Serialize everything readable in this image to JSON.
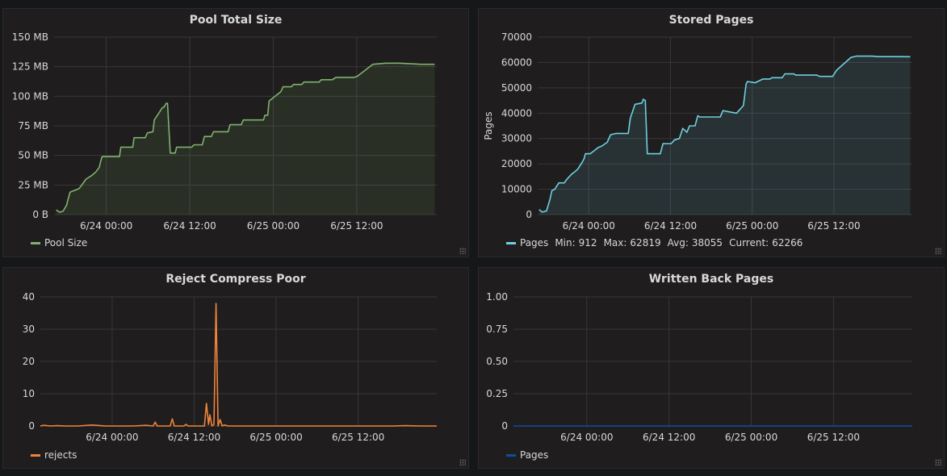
{
  "panels": [
    {
      "title": "Pool Total Size",
      "legend": {
        "name": "Pool Size",
        "color": "#7eb26d"
      },
      "chart_data": {
        "type": "area",
        "title": "Pool Total Size",
        "x_ticks": [
          "6/24 00:00",
          "6/24 12:00",
          "6/25 00:00",
          "6/25 12:00"
        ],
        "x_tick_hours": [
          15,
          27,
          39,
          51
        ],
        "x_range_hours": [
          7.5,
          62.5
        ],
        "y_ticks": [
          "0 B",
          "25 MB",
          "50 MB",
          "75 MB",
          "100 MB",
          "125 MB",
          "150 MB"
        ],
        "ylim": [
          0,
          150
        ],
        "y_unit": "MB",
        "color": "#7eb26d",
        "fill": true,
        "series": [
          {
            "name": "Pool Size",
            "x_hours": [
              7.8,
              8.3,
              8.8,
              9.3,
              9.6,
              9.8,
              10.2,
              11.1,
              11.6,
              12.1,
              12.9,
              13.5,
              14,
              14.2,
              14.4,
              16.9,
              17.1,
              18.8,
              19,
              20.6,
              20.9,
              21.7,
              21.9,
              22.8,
              23,
              23.3,
              23.6,
              23.8,
              24.2,
              24.9,
              25.1,
              27.3,
              27.6,
              28.8,
              29.1,
              30.1,
              30.4,
              32.5,
              32.8,
              34.4,
              34.7,
              37.6,
              37.8,
              38.2,
              38.4,
              40.1,
              40.4,
              41.6,
              41.9,
              43.1,
              43.4,
              45.6,
              45.9,
              47.5,
              48,
              50.6,
              51.1,
              53.3,
              55.2,
              57.2,
              60.2,
              62.2
            ],
            "values": [
              4,
              2,
              3,
              8,
              15,
              19,
              20,
              22,
              26,
              30,
              33,
              36,
              40,
              45,
              49,
              49,
              57,
              57,
              65,
              65,
              69,
              70,
              80,
              88,
              90,
              91,
              94,
              94,
              52,
              52,
              57,
              57,
              59,
              59,
              66,
              66,
              70,
              70,
              76,
              76,
              80,
              80,
              84,
              84,
              96,
              104,
              108,
              108,
              110,
              110,
              112,
              112,
              114,
              114,
              116,
              116,
              117,
              127,
              128,
              128,
              127,
              127
            ]
          }
        ]
      }
    },
    {
      "title": "Stored Pages",
      "legend": {
        "name": "Pages",
        "color": "#6ed0e0",
        "min_label": "Min:",
        "min": "912",
        "max_label": "Max:",
        "max": "62819",
        "avg_label": "Avg:",
        "avg": "38055",
        "current_label": "Current:",
        "current": "62266"
      },
      "chart_data": {
        "type": "area",
        "title": "Stored Pages",
        "ylabel": "Pages",
        "x_ticks": [
          "6/24 00:00",
          "6/24 12:00",
          "6/25 00:00",
          "6/25 12:00"
        ],
        "x_tick_hours": [
          15,
          27,
          39,
          51
        ],
        "x_range_hours": [
          7.5,
          62.5
        ],
        "y_ticks": [
          "0",
          "10000",
          "20000",
          "30000",
          "40000",
          "50000",
          "60000",
          "70000"
        ],
        "ylim": [
          0,
          70000
        ],
        "color": "#6ed0e0",
        "fill": true,
        "series": [
          {
            "name": "Pages",
            "x_hours": [
              7.7,
              8.2,
              8.8,
              9.3,
              9.6,
              10,
              10.6,
              11.4,
              11.8,
              12.5,
              13,
              13.4,
              14,
              14.3,
              14.5,
              15.2,
              16.4,
              16.9,
              17.7,
              18.2,
              19,
              20.8,
              21.1,
              21.8,
              22.8,
              23,
              23.3,
              23.6,
              23.9,
              24.1,
              25.5,
              25.9,
              27.1,
              27.6,
              28.3,
              28.8,
              29.4,
              29.8,
              30.6,
              31,
              31.3,
              31.7,
              34.3,
              34.7,
              36.7,
              37.7,
              38.1,
              38.3,
              39.4,
              40.2,
              40.6,
              41.6,
              41.9,
              43.4,
              43.8,
              45.1,
              45.4,
              48.5,
              48.9,
              50.8,
              51.4,
              53.5,
              54.3,
              56.6,
              57.5,
              60.1,
              62.2
            ],
            "values": [
              2000,
              1000,
              1500,
              6000,
              9500,
              10000,
              12500,
              12500,
              14000,
              16000,
              17000,
              18000,
              20500,
              22000,
              24000,
              24000,
              26500,
              27000,
              28500,
              31500,
              32000,
              32000,
              38000,
              43500,
              44000,
              45500,
              45000,
              24000,
              24000,
              24000,
              24000,
              28000,
              28000,
              29500,
              30000,
              34000,
              32500,
              35000,
              35000,
              39000,
              38500,
              38500,
              38500,
              41000,
              40000,
              43000,
              51500,
              52500,
              52000,
              53000,
              53500,
              53500,
              54000,
              54000,
              55500,
              55500,
              55000,
              55000,
              54500,
              54500,
              57000,
              62000,
              62500,
              62500,
              62300,
              62300,
              62266
            ]
          }
        ]
      }
    },
    {
      "title": "Reject Compress Poor",
      "legend": {
        "name": "rejects",
        "color": "#ef843c"
      },
      "chart_data": {
        "type": "line",
        "title": "Reject Compress Poor",
        "x_ticks": [
          "6/24 00:00",
          "6/24 12:00",
          "6/25 00:00",
          "6/25 12:00"
        ],
        "x_tick_hours": [
          15,
          27,
          39,
          51
        ],
        "x_range_hours": [
          4.5,
          62.5
        ],
        "y_ticks": [
          "0",
          "10",
          "20",
          "30",
          "40"
        ],
        "ylim": [
          0,
          40
        ],
        "color": "#ef843c",
        "fill": false,
        "series": [
          {
            "name": "rejects",
            "x_hours": [
              4.5,
              5,
              6,
              7,
              8,
              10,
              12,
              14,
              16,
              18,
              20,
              21,
              21.3,
              21.6,
              22,
              23.5,
              23.8,
              24.1,
              24.5,
              25.5,
              25.8,
              26.1,
              27,
              28.5,
              28.8,
              29.1,
              29.3,
              29.6,
              29.9,
              30.2,
              30.5,
              30.8,
              31.1,
              31.4,
              32,
              34,
              36,
              40,
              44,
              48,
              52,
              56,
              58,
              60,
              62.5
            ],
            "values": [
              0,
              0.2,
              0,
              0.1,
              0,
              0,
              0.3,
              0,
              0,
              0,
              0.2,
              0,
              1.2,
              0,
              0,
              0,
              2.2,
              0,
              0,
              0,
              0.5,
              0,
              0,
              0,
              7,
              0.5,
              3.5,
              0,
              0.5,
              38,
              0,
              2,
              0,
              0.3,
              0,
              0,
              0,
              0,
              0,
              0,
              0,
              0,
              0.1,
              0,
              0
            ]
          }
        ]
      }
    },
    {
      "title": "Written Back Pages",
      "legend": {
        "name": "Pages",
        "color": "#0a50a1"
      },
      "chart_data": {
        "type": "line",
        "title": "Written Back Pages",
        "x_ticks": [
          "6/24 00:00",
          "6/24 12:00",
          "6/25 00:00",
          "6/25 12:00"
        ],
        "x_tick_hours": [
          15,
          27,
          39,
          51
        ],
        "x_range_hours": [
          4.3,
          62.5
        ],
        "y_ticks": [
          "0",
          "0.25",
          "0.50",
          "0.75",
          "1.00"
        ],
        "ylim": [
          0,
          1
        ],
        "color": "#0a50a1",
        "fill": false,
        "series": [
          {
            "name": "Pages",
            "x_hours": [
              4.3,
              62.5
            ],
            "values": [
              0,
              0
            ]
          }
        ]
      }
    }
  ]
}
